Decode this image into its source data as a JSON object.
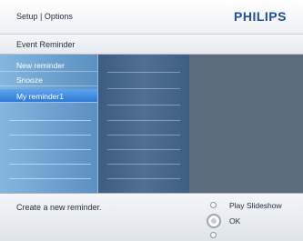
{
  "header": {
    "breadcrumb": "Setup | Options",
    "brand": "PHILIPS"
  },
  "page": {
    "title": "Event Reminder"
  },
  "menu": {
    "items": [
      {
        "label": "New reminder",
        "selected": false
      },
      {
        "label": "Snooze",
        "selected": false
      },
      {
        "label": "My reminder1",
        "selected": true
      }
    ]
  },
  "footer": {
    "hint": "Create a new reminder.",
    "nav_up_label": "Play Slideshow",
    "nav_ok_label": "OK"
  },
  "colors": {
    "brand": "#1e4f9a",
    "selected_item": "#2d7ad6"
  }
}
